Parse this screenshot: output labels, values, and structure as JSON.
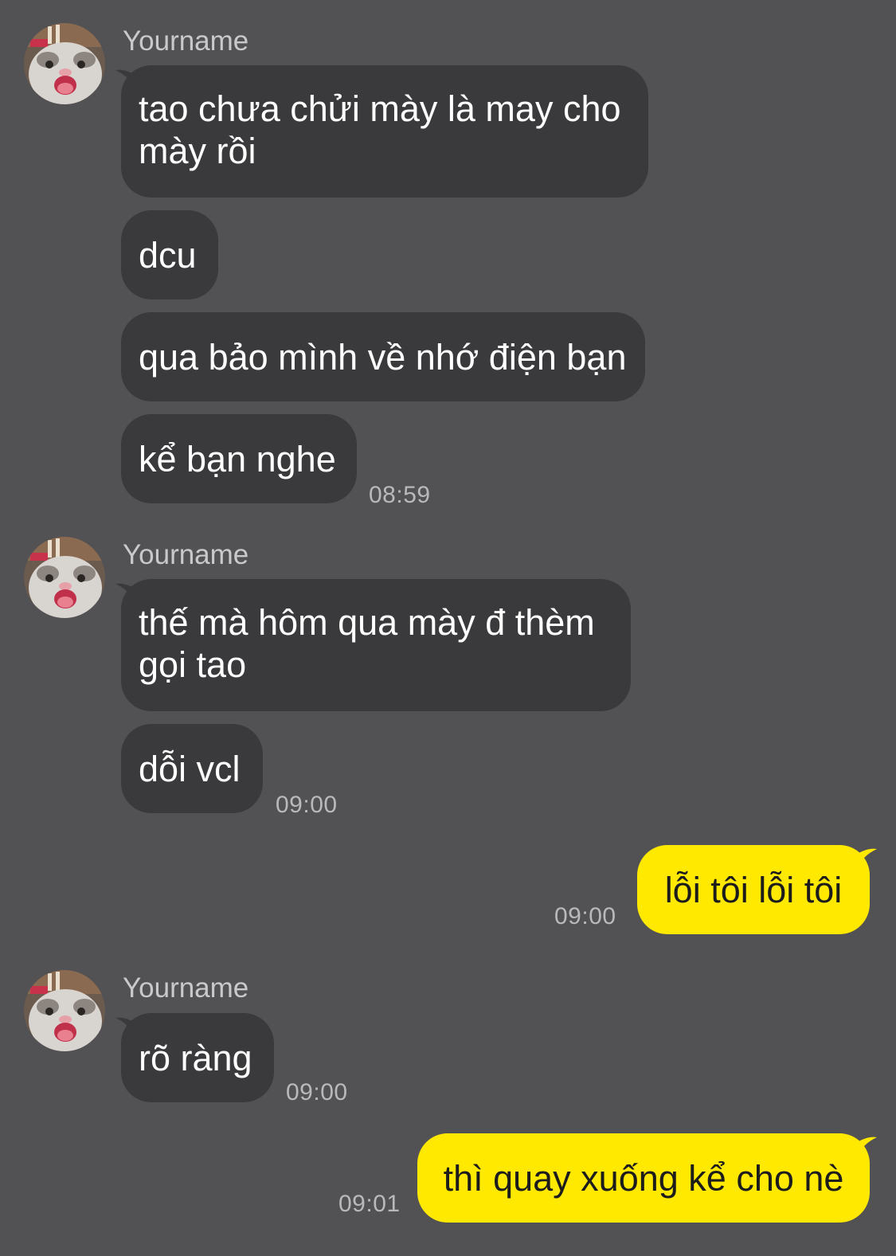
{
  "colors": {
    "background": "#525154",
    "incoming_bubble": "#3a3a3d",
    "outgoing_bubble": "#ffe900",
    "sender_text": "#c9c9cc",
    "time_text": "#b9b9bc"
  },
  "groups": [
    {
      "sender": "Yourname",
      "avatar_icon": "cat-avatar-icon",
      "messages": [
        "tao chưa chửi mày là may cho mày rồi",
        "dcu",
        "qua bảo mình về nhớ điện bạn",
        "kể bạn nghe"
      ],
      "time": "08:59"
    },
    {
      "sender": "Yourname",
      "avatar_icon": "cat-avatar-icon",
      "messages": [
        "thế mà hôm qua mày đ thèm gọi tao",
        "dỗi vcl"
      ],
      "time": "09:00"
    },
    {
      "outgoing": true,
      "messages": [
        "lỗi tôi lỗi tôi"
      ],
      "time": "09:00"
    },
    {
      "sender": "Yourname",
      "avatar_icon": "cat-avatar-icon",
      "messages": [
        "rõ ràng"
      ],
      "time": "09:00"
    },
    {
      "outgoing": true,
      "messages": [
        "thì quay xuống kể cho nè"
      ],
      "time": "09:01"
    }
  ]
}
